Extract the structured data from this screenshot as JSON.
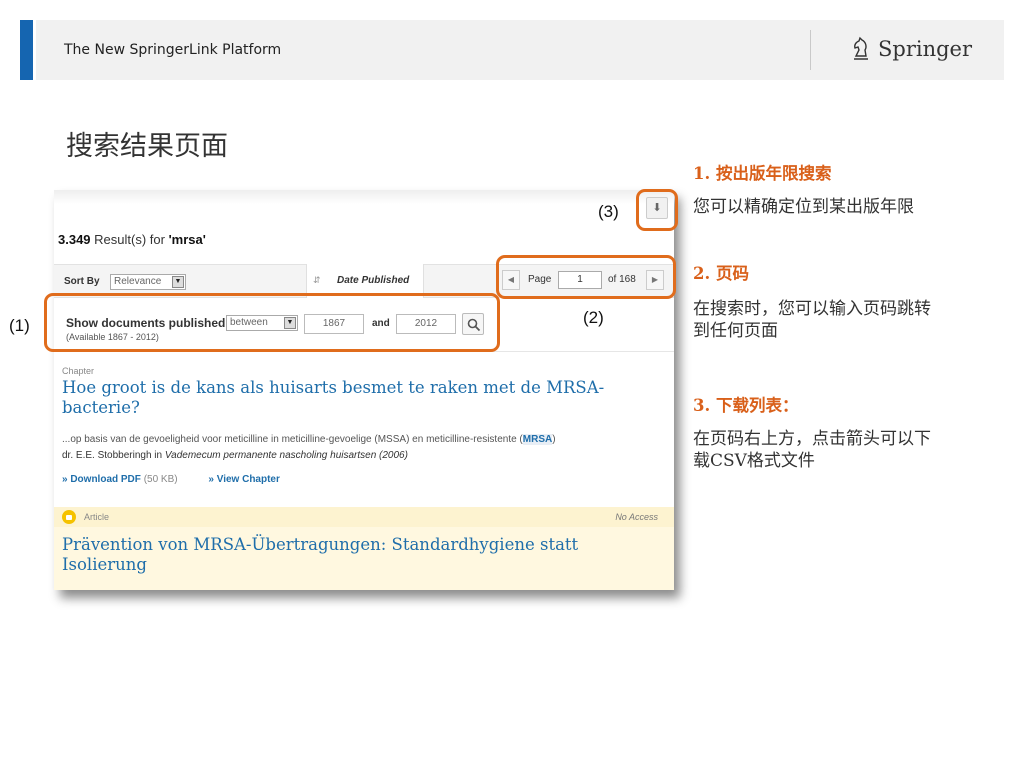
{
  "header": {
    "title": "The New SpringerLink Platform",
    "logo_text": "Springer",
    "accent_color": "#1565b0",
    "logo_icon": "chess-knight-icon"
  },
  "slide_title": "搜索结果页面",
  "screenshot": {
    "count": "3.349",
    "count_text": " Result(s) for ",
    "query": "'mrsa'",
    "sort_by_label": "Sort By",
    "sort_value": "Relevance",
    "date_published": "Date Published",
    "pager": {
      "page_label": "Page",
      "page_value": "1",
      "of_label": "of 168"
    },
    "filter": {
      "title": "Show documents published",
      "mode": "between",
      "from": "1867",
      "and_label": "and",
      "to": "2012",
      "available": "(Available 1867 - 2012)"
    },
    "results": [
      {
        "type": "Chapter",
        "title_line1": "Hoe groot is de kans als huisarts besmet te raken met de MRSA-",
        "title_line2": "bacterie?",
        "snippet_pre": "...op basis van de gevoeligheid voor meticilline in meticilline-gevoelige (MSSA) en meticilline-resistente (",
        "snippet_hl": "MRSA",
        "snippet_post": ")",
        "author": "dr. E.E. Stobberingh in ",
        "source": "Vademecum permanente nascholing huisartsen (2006)",
        "download_label": "» Download PDF",
        "download_size": "(50 KB)",
        "view_label": "» View Chapter"
      },
      {
        "type": "Article",
        "access": "No Access",
        "title_line1": "Prävention von MRSA-Übertragungen: Standardhygiene statt",
        "title_line2": "Isolierung"
      }
    ]
  },
  "annotations": {
    "a1": "(1)",
    "a2": "(2)",
    "a3": "(3)",
    "color": "#e06c1c"
  },
  "side": {
    "h1": "1.  按出版年限搜索",
    "p1": "您可以精确定位到某出版年限",
    "h2": "2.  页码",
    "p2_line1": "在搜索时，您可以输入页码跳转",
    "p2_line2": "到任何页面",
    "h3": "3.  下载列表：",
    "p3_line1": "在页码右上方，点击箭头可以下",
    "p3_line2": "载CSV格式文件"
  }
}
